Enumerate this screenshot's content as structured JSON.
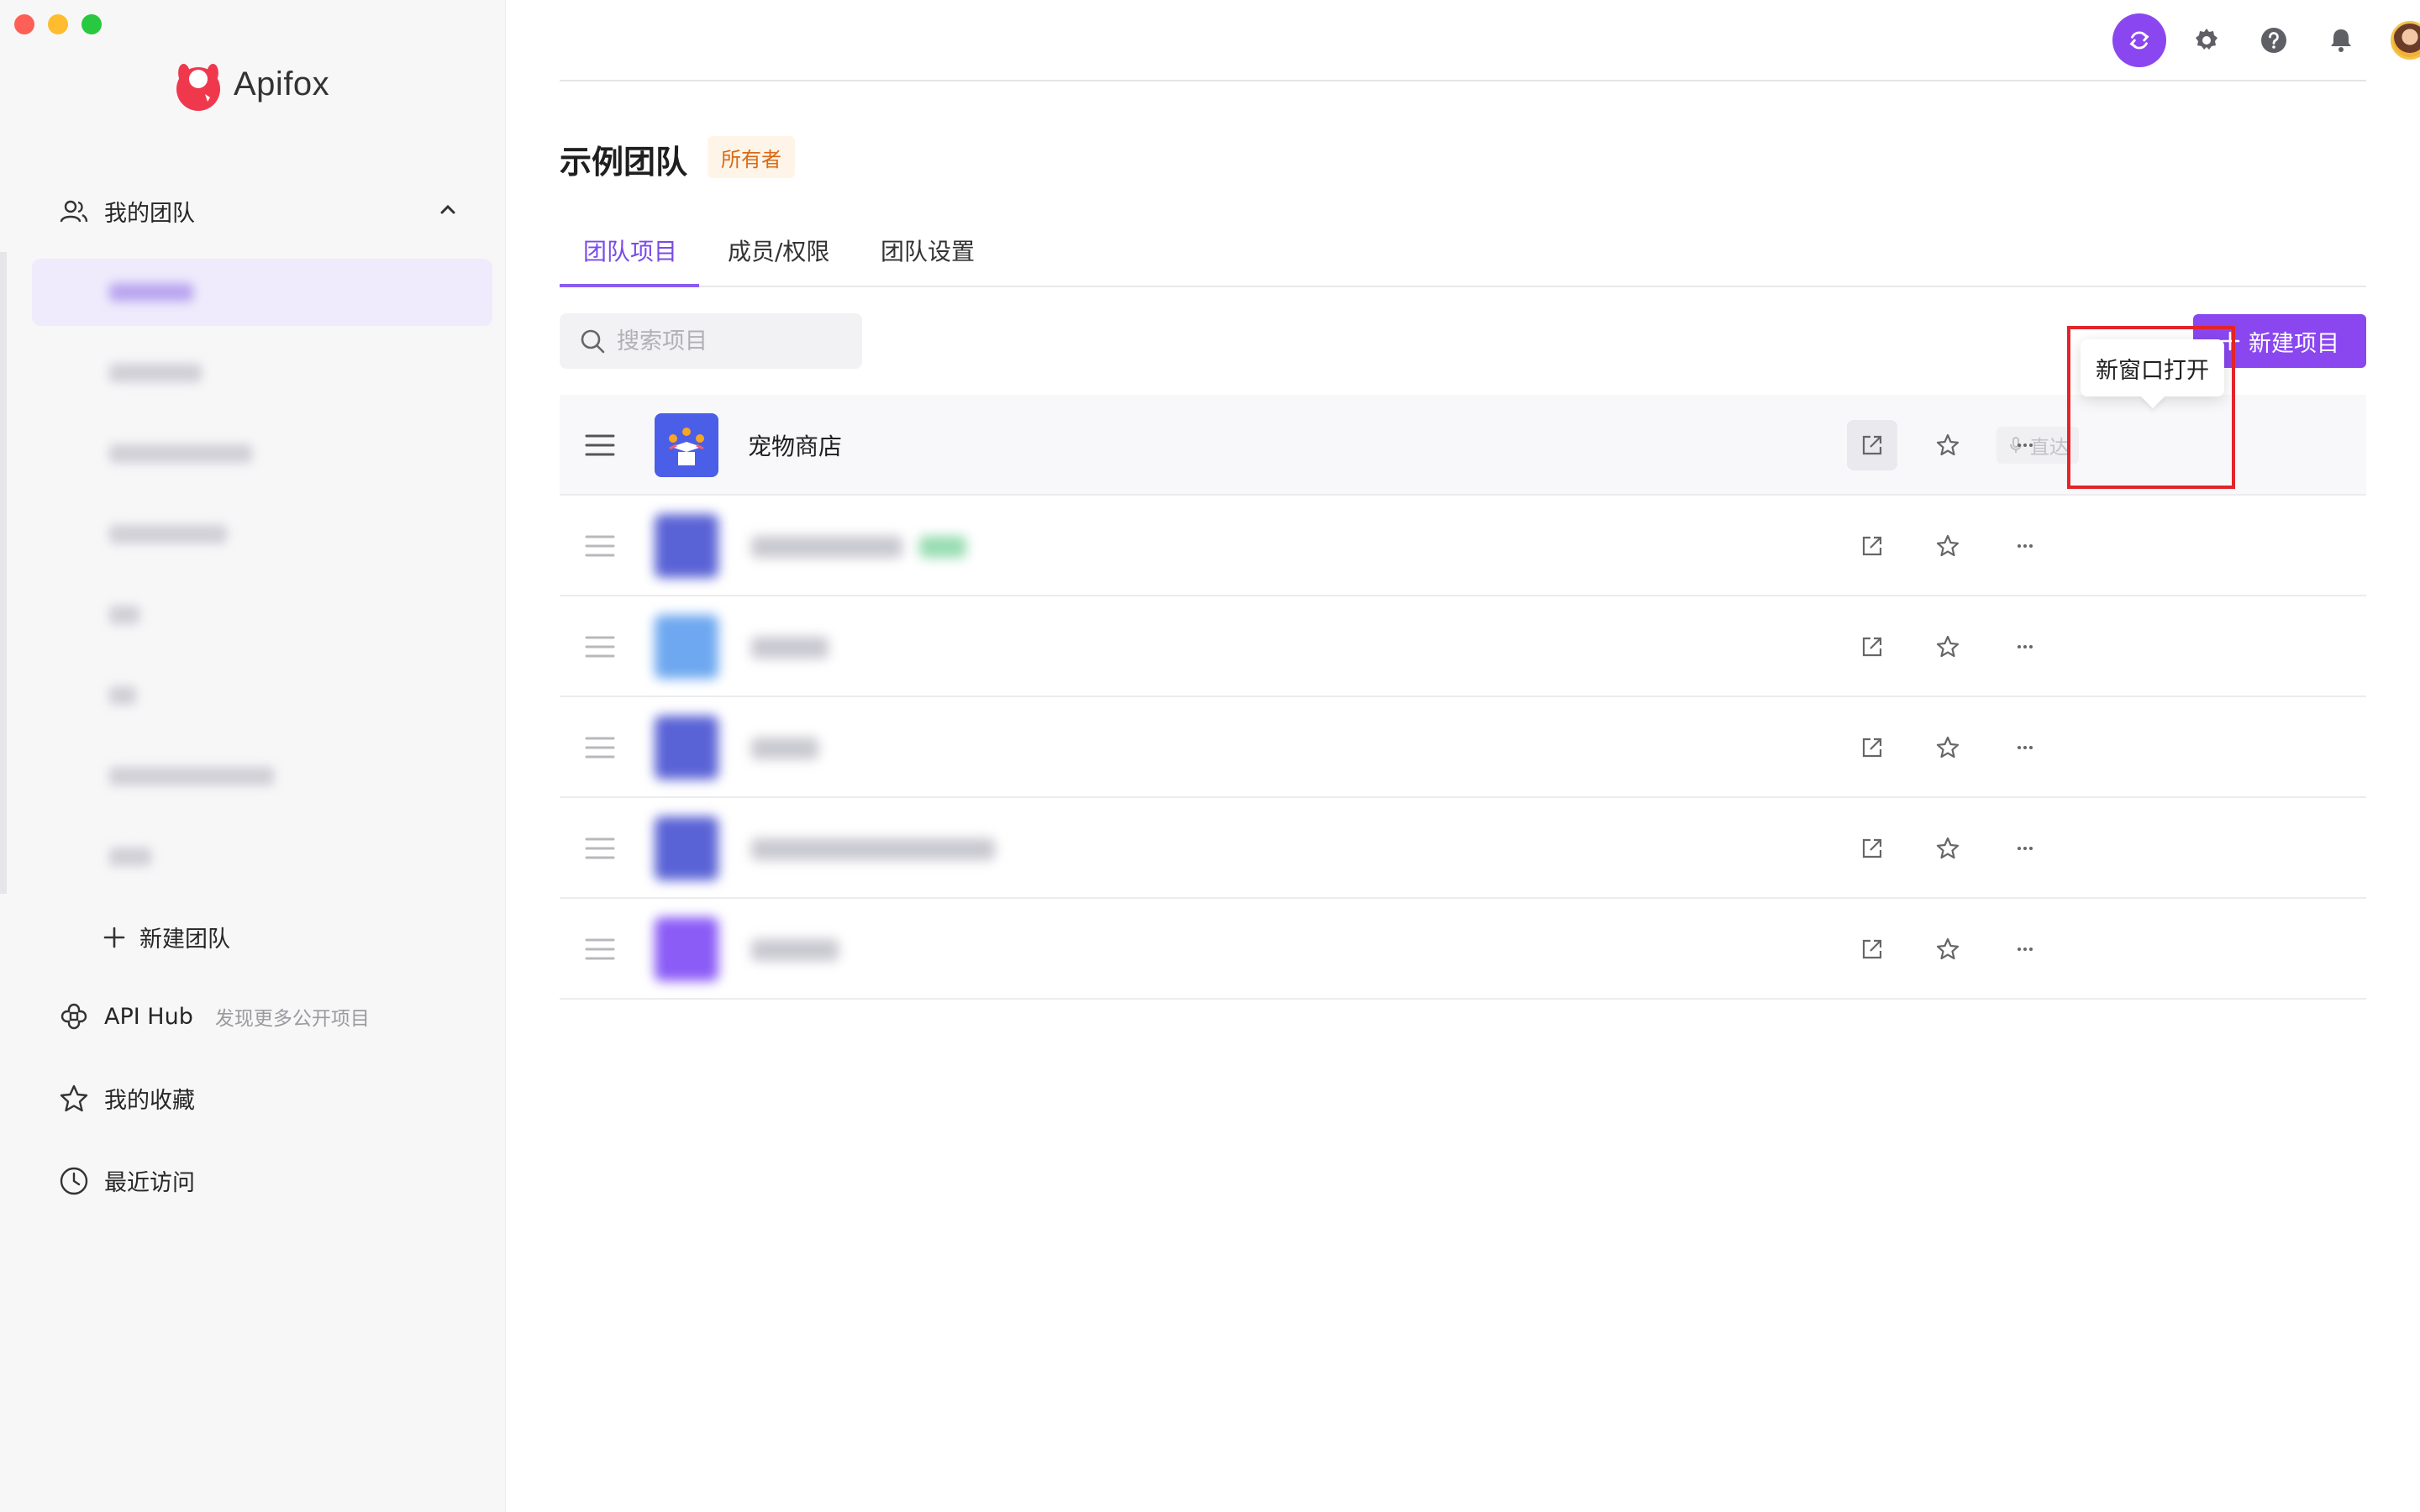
{
  "app": {
    "name": "Apifox"
  },
  "window": {
    "traffic_lights": [
      "close",
      "minimize",
      "zoom"
    ]
  },
  "sidebar": {
    "my_team_label": "我的团队",
    "new_team_label": "新建团队",
    "api_hub_label": "API Hub",
    "api_hub_sub": "发现更多公开项目",
    "favorites_label": "我的收藏",
    "recent_label": "最近访问",
    "teams": [
      {
        "label": "",
        "active": true
      },
      {
        "label": "",
        "active": false
      },
      {
        "label": "",
        "active": false
      },
      {
        "label": "",
        "active": false
      },
      {
        "label": "",
        "active": false
      },
      {
        "label": "",
        "active": false
      },
      {
        "label": "",
        "active": false
      },
      {
        "label": "",
        "active": false
      }
    ]
  },
  "header": {
    "icons": [
      "sync-icon",
      "gear-icon",
      "help-icon",
      "bell-icon",
      "avatar"
    ]
  },
  "page": {
    "title": "示例团队",
    "badge": "所有者",
    "tabs": [
      {
        "label": "团队项目",
        "active": true
      },
      {
        "label": "成员/权限",
        "active": false
      },
      {
        "label": "团队设置",
        "active": false
      }
    ],
    "search_placeholder": "搜索项目",
    "new_project_label": "新建项目",
    "tooltip": "新窗口打开"
  },
  "projects": [
    {
      "name": "宠物商店",
      "direct_label": "直达",
      "hover": true
    },
    {
      "name": "",
      "hover": false
    },
    {
      "name": "",
      "hover": false
    },
    {
      "name": "",
      "hover": false
    },
    {
      "name": "",
      "hover": false
    },
    {
      "name": "",
      "hover": false
    }
  ],
  "colors": {
    "accent": "#8a47f0",
    "tab_active": "#7a4be8",
    "owner_badge_bg": "#fff4e8",
    "owner_badge_text": "#d96a13",
    "highlight_box": "#e3242b"
  }
}
